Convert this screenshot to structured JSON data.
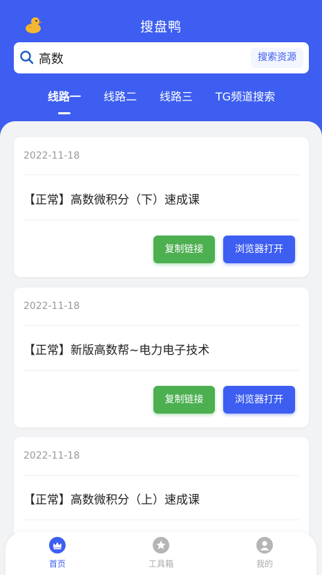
{
  "app": {
    "title": "搜盘鸭"
  },
  "search": {
    "value": "高数",
    "placeholder": "",
    "button_label": "搜索资源"
  },
  "tabs": [
    {
      "label": "线路一",
      "active": true
    },
    {
      "label": "线路二",
      "active": false
    },
    {
      "label": "线路三",
      "active": false
    },
    {
      "label": "TG频道搜索",
      "active": false
    }
  ],
  "results": [
    {
      "date": "2022-11-18",
      "title": "【正常】高数微积分（下）速成课"
    },
    {
      "date": "2022-11-18",
      "title": "【正常】新版高数帮~电力电子技术"
    },
    {
      "date": "2022-11-18",
      "title": "【正常】高数微积分（上）速成课"
    }
  ],
  "buttons": {
    "copy_label": "复制链接",
    "open_label": "浏览器打开"
  },
  "bottom_nav": [
    {
      "label": "首页",
      "icon": "crown-icon",
      "active": true
    },
    {
      "label": "工具箱",
      "icon": "star-icon",
      "active": false
    },
    {
      "label": "我的",
      "icon": "user-icon",
      "active": false
    }
  ],
  "colors": {
    "primary": "#3d5ef0",
    "success": "#4caf50",
    "background": "#f2f3f5"
  }
}
